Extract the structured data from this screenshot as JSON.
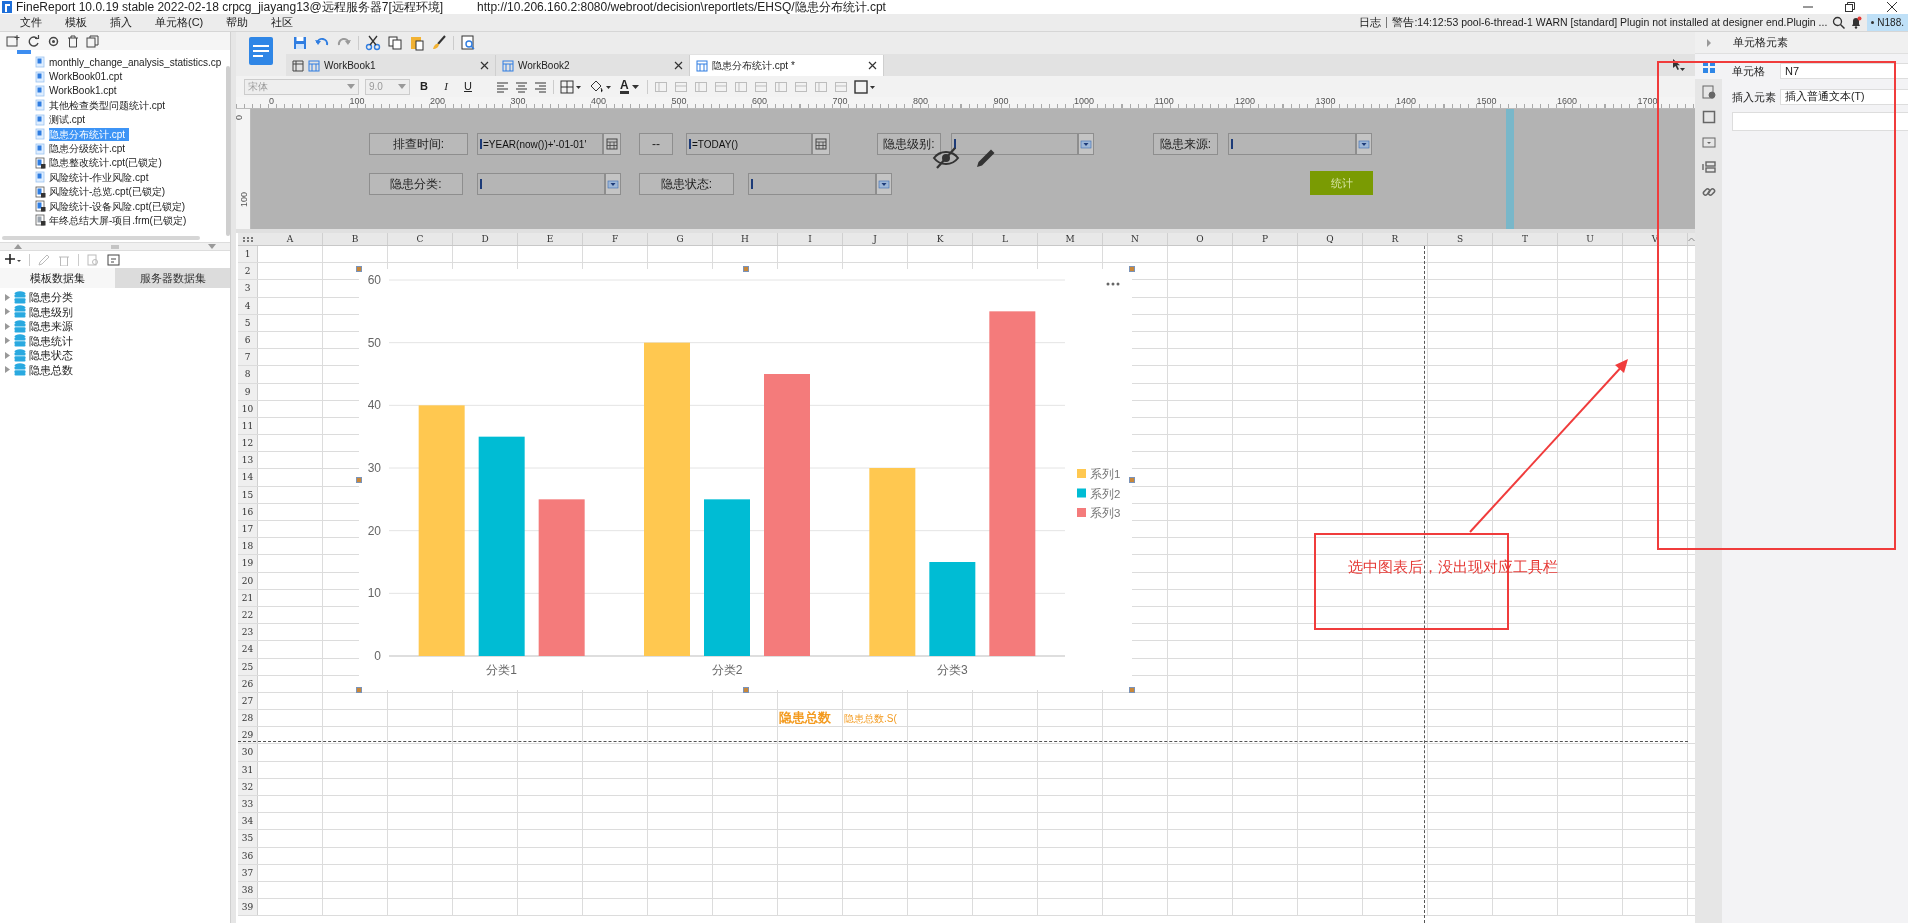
{
  "window": {
    "title": "FineReport 10.0.19 stable 2022-02-18 crpcg_jiayang13@远程服务器7[远程环境]",
    "url": "http://10.206.160.2:8080/webroot/decision\\reportlets/EHSQ/隐患分布统计.cpt"
  },
  "menu": [
    "文件",
    "模板",
    "插入",
    "单元格(C)",
    "帮助",
    "社区"
  ],
  "log": {
    "label": "日志",
    "message": "警告:14:12:53 pool-6-thread-1 WARN [standard] Plugin not installed at designer end.Plugin ...",
    "user": "N188."
  },
  "file_tree": [
    {
      "name": "monthly_change_analysis_statistics.cp",
      "kind": "cpt",
      "locked": false,
      "selected": false
    },
    {
      "name": "WorkBook01.cpt",
      "kind": "cpt",
      "locked": false,
      "selected": false
    },
    {
      "name": "WorkBook1.cpt",
      "kind": "cpt",
      "locked": false,
      "selected": false
    },
    {
      "name": "其他检查类型问题统计.cpt",
      "kind": "cpt",
      "locked": false,
      "selected": false
    },
    {
      "name": "测试.cpt",
      "kind": "cpt",
      "locked": false,
      "selected": false
    },
    {
      "name": "隐患分布统计.cpt",
      "kind": "cpt",
      "locked": false,
      "selected": true
    },
    {
      "name": "隐患分级统计.cpt",
      "kind": "cpt",
      "locked": false,
      "selected": false
    },
    {
      "name": "隐患整改统计.cpt(已锁定)",
      "kind": "cpt",
      "locked": true,
      "selected": false
    },
    {
      "name": "风险统计-作业风险.cpt",
      "kind": "cpt",
      "locked": false,
      "selected": false
    },
    {
      "name": "风险统计-总览.cpt(已锁定)",
      "kind": "cpt",
      "locked": true,
      "selected": false
    },
    {
      "name": "风险统计-设备风险.cpt(已锁定)",
      "kind": "cpt",
      "locked": true,
      "selected": false
    },
    {
      "name": "年终总结大屏-项目.frm(已锁定)",
      "kind": "frm",
      "locked": true,
      "selected": false
    }
  ],
  "datasets": {
    "tabs": [
      {
        "label": "模板数据集",
        "selected": true
      },
      {
        "label": "服务器数据集",
        "selected": false
      }
    ],
    "items": [
      {
        "name": "隐患分类",
        "expanded": false
      },
      {
        "name": "隐患级别",
        "expanded": false
      },
      {
        "name": "隐患来源",
        "expanded": false
      },
      {
        "name": "隐患统计",
        "expanded": false
      },
      {
        "name": "隐患状态",
        "expanded": false
      },
      {
        "name": "隐患总数",
        "expanded": false
      }
    ]
  },
  "editor_tabs": [
    {
      "label": "WorkBook1",
      "selected": false
    },
    {
      "label": "WorkBook2",
      "selected": false
    },
    {
      "label": "隐患分布统计.cpt *",
      "selected": true
    }
  ],
  "format_toolbar": {
    "font": "宋体",
    "size": "9.0",
    "style_buttons": [
      "B",
      "I",
      "U"
    ],
    "font_color": "A"
  },
  "ruler": [
    "0",
    "100",
    "200",
    "300",
    "400",
    "500",
    "600",
    "700",
    "800",
    "900",
    "1000",
    "1100",
    "1200",
    "1300",
    "1400",
    "1500",
    "1600",
    "1700"
  ],
  "vertical_ruler": [
    "0",
    "100"
  ],
  "parameters": [
    {
      "kind": "label",
      "text": "排查时间:"
    },
    {
      "kind": "date",
      "value": "=YEAR(now())+'-01-01'"
    },
    {
      "kind": "label",
      "text": "--"
    },
    {
      "kind": "date",
      "value": "=TODAY()"
    },
    {
      "kind": "label",
      "text": "隐患级别:"
    },
    {
      "kind": "combo"
    },
    {
      "kind": "label",
      "text": "隐患来源:"
    },
    {
      "kind": "combo"
    },
    {
      "kind": "label",
      "text": "隐患分类:"
    },
    {
      "kind": "combo"
    },
    {
      "kind": "label",
      "text": "隐患状态:"
    },
    {
      "kind": "combo"
    },
    {
      "kind": "button",
      "text": "统计"
    }
  ],
  "sheet": {
    "columns": [
      "A",
      "B",
      "C",
      "D",
      "E",
      "F",
      "G",
      "H",
      "I",
      "J",
      "K",
      "L",
      "M",
      "N",
      "O",
      "P",
      "Q",
      "R",
      "S",
      "T",
      "U",
      "V"
    ],
    "rows": [
      {
        "label": "1"
      },
      {
        "label": "2"
      },
      {
        "label": "3"
      },
      {
        "label": "4"
      },
      {
        "label": "5"
      },
      {
        "label": "6"
      },
      {
        "label": "7"
      },
      {
        "label": "8"
      },
      {
        "label": "9"
      },
      {
        "label": "10"
      },
      {
        "label": "11"
      },
      {
        "label": "12"
      },
      {
        "label": "13"
      },
      {
        "label": "14"
      },
      {
        "label": "15"
      },
      {
        "label": "16"
      },
      {
        "label": "17"
      },
      {
        "label": "18"
      },
      {
        "label": "19"
      },
      {
        "label": "20"
      },
      {
        "label": "21"
      },
      {
        "label": "22"
      },
      {
        "label": "23"
      },
      {
        "label": "24"
      },
      {
        "label": "25"
      },
      {
        "label": "26"
      },
      {
        "label": "27"
      },
      {
        "label": "28",
        "cells": [
          {
            "text": "隐患总数",
            "kind": "title"
          },
          {
            "text": "隐患总数.S(",
            "kind": "formula"
          }
        ]
      },
      {
        "label": "29"
      },
      {
        "label": "30"
      },
      {
        "label": "31"
      },
      {
        "label": "32"
      },
      {
        "label": "33"
      },
      {
        "label": "34"
      },
      {
        "label": "35"
      },
      {
        "label": "36"
      },
      {
        "label": "37"
      },
      {
        "label": "38"
      },
      {
        "label": "39"
      }
    ],
    "chart_data": {
      "type": "bar",
      "categories": [
        "分类1",
        "分类2",
        "分类3"
      ],
      "series": [
        {
          "name": "系列1",
          "color": "#ffc850",
          "values": [
            40,
            50,
            30
          ]
        },
        {
          "name": "系列2",
          "color": "#00bcd4",
          "values": [
            35,
            25,
            15
          ]
        },
        {
          "name": "系列3",
          "color": "#f47b7b",
          "values": [
            25,
            45,
            55
          ]
        }
      ],
      "ylim": [
        0,
        60
      ],
      "yticks": [
        {
          "value": 0,
          "label": "0"
        },
        {
          "value": 10,
          "label": "10"
        },
        {
          "value": 20,
          "label": "20"
        },
        {
          "value": 30,
          "label": "30"
        },
        {
          "value": 40,
          "label": "40"
        },
        {
          "value": 50,
          "label": "50"
        },
        {
          "value": 60,
          "label": "60"
        }
      ],
      "grid": true,
      "legend": true
    }
  },
  "cell_panel": {
    "title": "单元格元素",
    "cell_label": "单元格",
    "cell": "N7",
    "insert_label": "插入元素",
    "insert_value": "插入普通文本(T)",
    "side_tabs": [
      {
        "selected": true
      },
      {
        "selected": false
      },
      {
        "selected": false
      },
      {
        "selected": false
      },
      {
        "selected": false
      },
      {
        "selected": false
      }
    ]
  },
  "annotation": {
    "text": "选中图表后，没出现对应工具栏"
  }
}
